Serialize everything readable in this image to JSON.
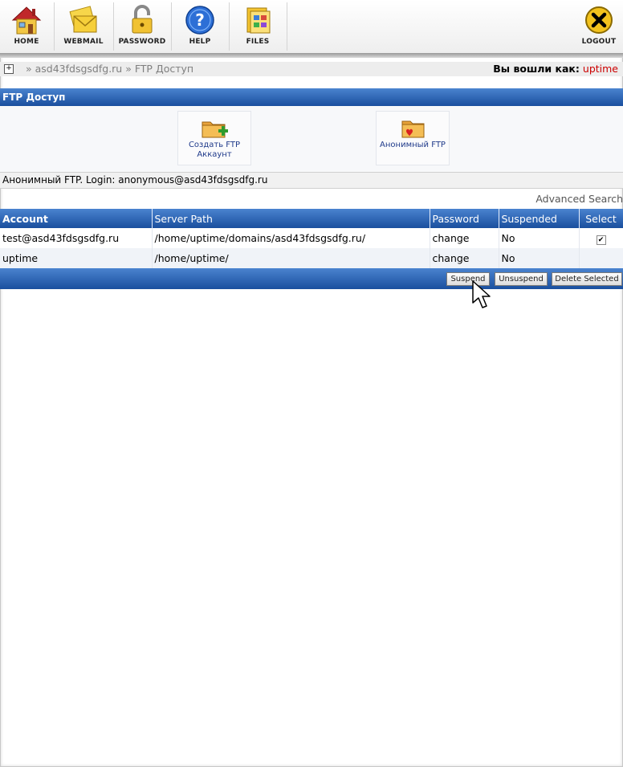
{
  "toolbar": {
    "items": [
      {
        "label": "HOME",
        "icon": "home-icon"
      },
      {
        "label": "WEBMAIL",
        "icon": "webmail-icon"
      },
      {
        "label": "PASSWORD",
        "icon": "lock-icon"
      },
      {
        "label": "HELP",
        "icon": "help-icon"
      },
      {
        "label": "FILES",
        "icon": "files-icon"
      }
    ],
    "logout": {
      "label": "LOGOUT",
      "icon": "logout-icon"
    }
  },
  "breadcrumb": {
    "path": "» asd43fdsgsdfg.ru » FTP Доступ",
    "logged_in_label": "Вы вошли как:",
    "user": "uptime"
  },
  "section": {
    "title": "FTP Доступ"
  },
  "actions": [
    {
      "label": "Создать FTP Аккаунт",
      "icon": "folder-add-icon"
    },
    {
      "label": "Анонимный FTP",
      "icon": "folder-heart-icon"
    }
  ],
  "anon_info": "Анонимный FTP. Login: anonymous@asd43fdsgsdfg.ru",
  "advanced_search": "Advanced Search",
  "table": {
    "headers": {
      "account": "Account",
      "path": "Server Path",
      "password": "Password",
      "suspended": "Suspended",
      "select": "Select"
    },
    "rows": [
      {
        "account": "test@asd43fdsgsdfg.ru",
        "path": "/home/uptime/domains/asd43fdsgsdfg.ru/",
        "password": "change",
        "suspended": "No",
        "selected": true
      },
      {
        "account": "uptime",
        "path": "/home/uptime/",
        "password": "change",
        "suspended": "No",
        "selected": false
      }
    ]
  },
  "buttons": {
    "suspend": "Suspend",
    "unsuspend": "Unsuspend",
    "delete": "Delete Selected"
  },
  "colors": {
    "header_blue": "#1a4f9e",
    "user_red": "#cc0000",
    "link_blue": "#1f3a8a"
  }
}
